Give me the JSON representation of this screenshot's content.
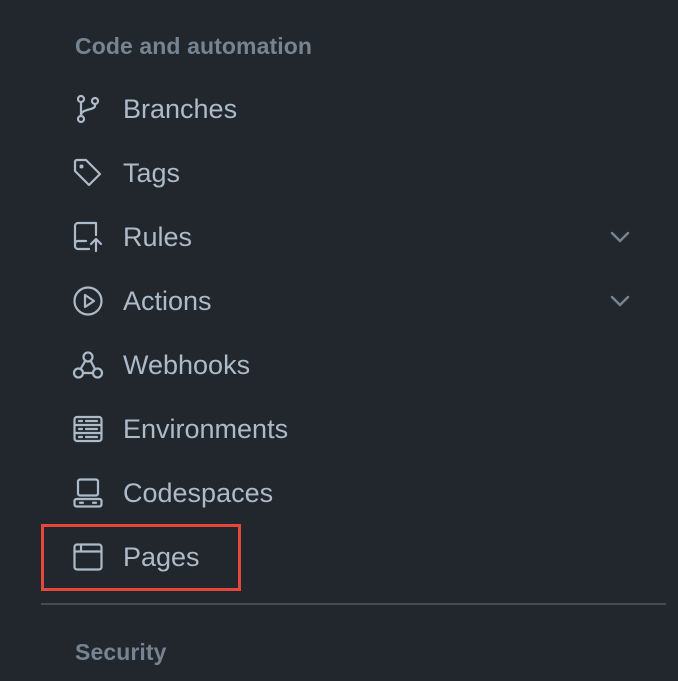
{
  "sections": {
    "code_automation": {
      "heading": "Code and automation"
    },
    "security": {
      "heading": "Security"
    }
  },
  "nav": {
    "items": [
      {
        "label": "Branches",
        "icon": "git-branch-icon"
      },
      {
        "label": "Tags",
        "icon": "tag-icon"
      },
      {
        "label": "Rules",
        "icon": "repo-push-icon",
        "expandable": true
      },
      {
        "label": "Actions",
        "icon": "play-icon",
        "expandable": true
      },
      {
        "label": "Webhooks",
        "icon": "webhook-icon"
      },
      {
        "label": "Environments",
        "icon": "server-icon"
      },
      {
        "label": "Codespaces",
        "icon": "codespaces-icon"
      },
      {
        "label": "Pages",
        "icon": "browser-icon",
        "highlighted": true
      }
    ]
  },
  "colors": {
    "background": "#22272e",
    "text": "#adbac7",
    "muted": "#768390",
    "highlight": "#e5483a",
    "divider": "#444c56"
  }
}
